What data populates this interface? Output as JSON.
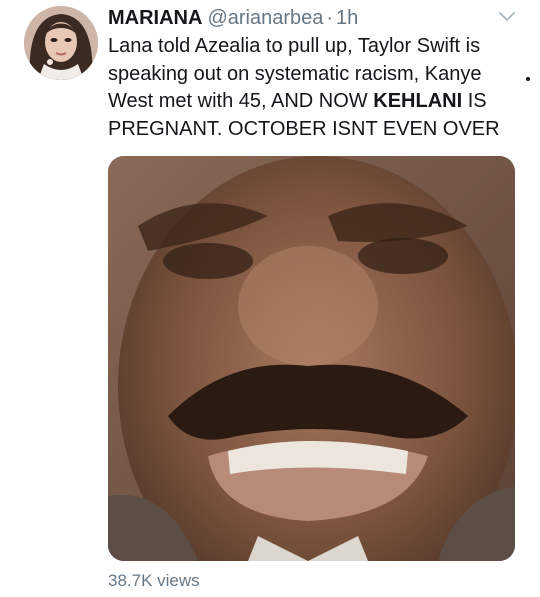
{
  "tweet": {
    "display_name": "MARIANA",
    "handle": "@arianarbea",
    "separator": "·",
    "time": "1h",
    "text_before": "Lana told Azealia to pull up, Taylor Swift is speaking out on systematic racism, Kanye West met with 45, AND NOW ",
    "text_bold": "KEHLANI",
    "text_after": " IS PREGNANT. OCTOBER ISNT EVEN OVER",
    "views": "38.7K views"
  },
  "icons": {
    "menu": "chevron-down-icon"
  },
  "colors": {
    "text": "#14171a",
    "secondary_text": "#657786",
    "chevron": "#aab8c2"
  }
}
